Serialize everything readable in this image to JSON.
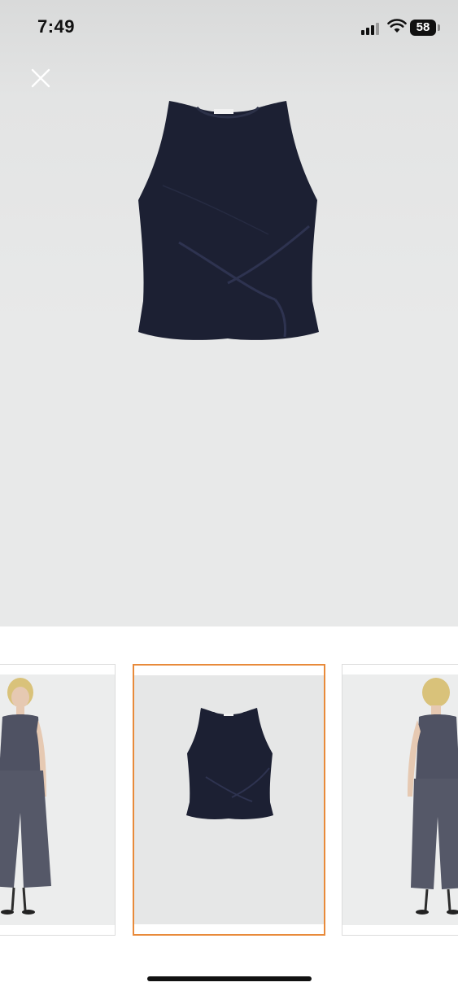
{
  "status_bar": {
    "time": "7:49",
    "battery_level": "58",
    "signal_icon": "cellular-signal-icon",
    "wifi_icon": "wifi-icon"
  },
  "viewer": {
    "close_icon": "close-icon",
    "main_image": "navy-sleeveless-knot-top",
    "colors": {
      "garment": "#1c2033",
      "background": "#e8e9e9",
      "selected_border": "#e88a3a"
    }
  },
  "thumbnails": [
    {
      "image": "model-front-view",
      "selected": false
    },
    {
      "image": "product-flat-lay",
      "selected": true
    },
    {
      "image": "model-back-view",
      "selected": false
    }
  ]
}
